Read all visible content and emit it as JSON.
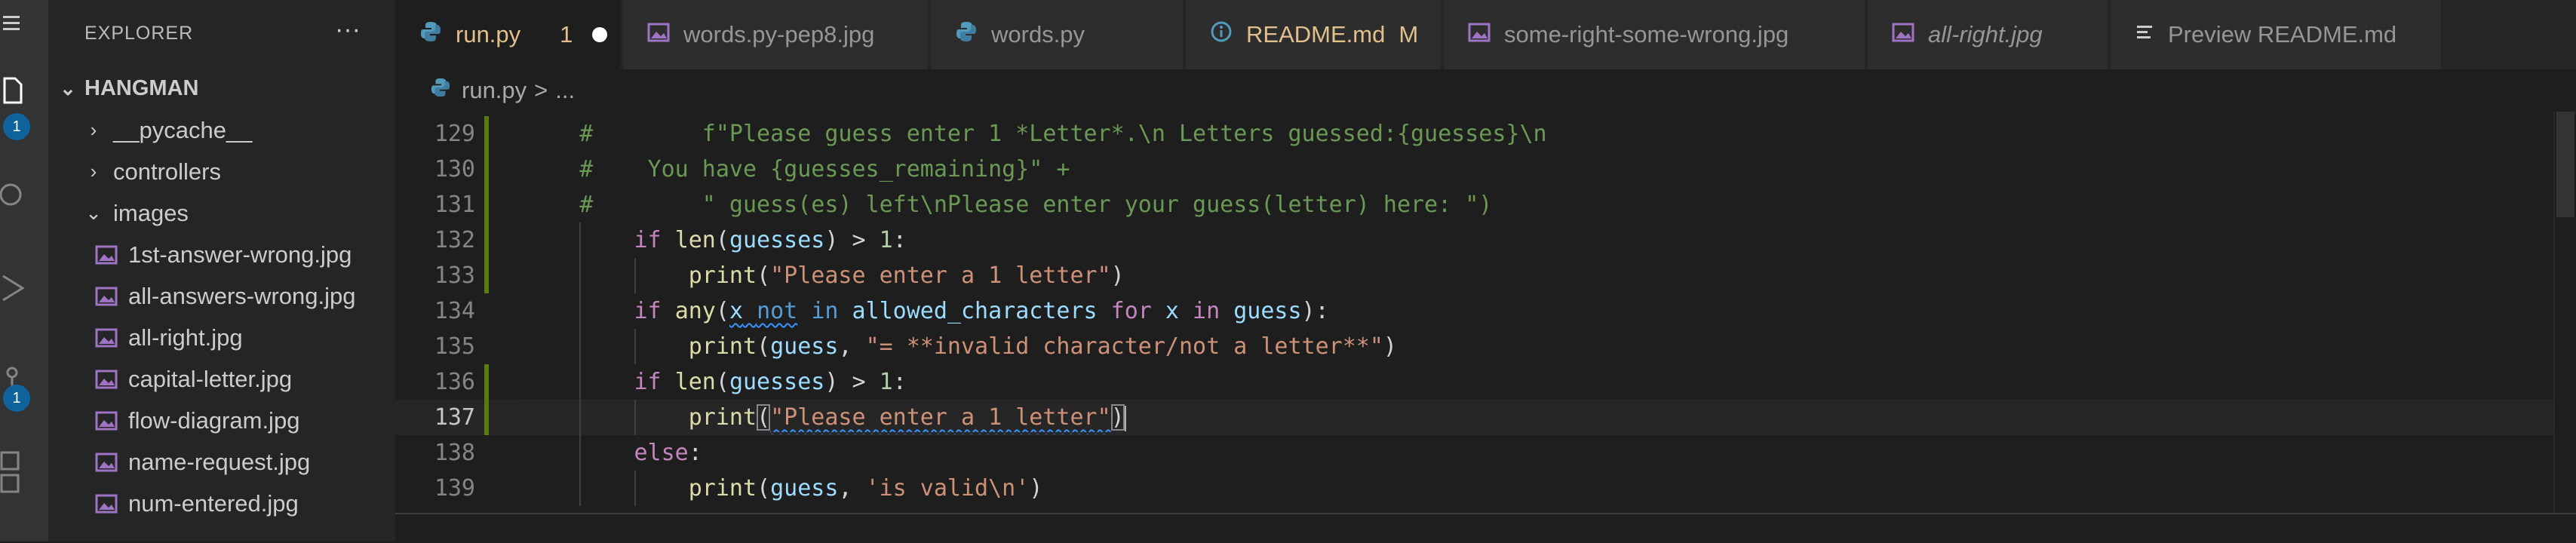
{
  "explorer": {
    "title": "EXPLORER",
    "more_label": "···",
    "root_label": "HANGMAN",
    "items": [
      {
        "label": "__pycache__",
        "kind": "folder",
        "expanded": false
      },
      {
        "label": "controllers",
        "kind": "folder",
        "expanded": false
      },
      {
        "label": "images",
        "kind": "folder",
        "expanded": true
      },
      {
        "label": "1st-answer-wrong.jpg",
        "kind": "image"
      },
      {
        "label": "all-answers-wrong.jpg",
        "kind": "image"
      },
      {
        "label": "all-right.jpg",
        "kind": "image"
      },
      {
        "label": "capital-letter.jpg",
        "kind": "image"
      },
      {
        "label": "flow-diagram.jpg",
        "kind": "image"
      },
      {
        "label": "name-request.jpg",
        "kind": "image"
      },
      {
        "label": "num-entered.jpg",
        "kind": "image"
      }
    ]
  },
  "activity": {
    "explorer_badge": "1",
    "scm_badge": "1"
  },
  "tabs": [
    {
      "label": "run.py",
      "icon": "python-icon",
      "count": "1",
      "unsaved": true,
      "active": true
    },
    {
      "label": "words.py-pep8.jpg",
      "icon": "image-icon"
    },
    {
      "label": "words.py",
      "icon": "python-icon"
    },
    {
      "label": "README.md",
      "icon": "info-icon",
      "status": "M"
    },
    {
      "label": "some-right-some-wrong.jpg",
      "icon": "image-icon"
    },
    {
      "label": "all-right.jpg",
      "icon": "image-icon",
      "italic": true
    },
    {
      "label": "Preview README.md",
      "icon": "preview-icon"
    }
  ],
  "breadcrumb": {
    "file": "run.py",
    "separator": ">",
    "ellipsis": "..."
  },
  "editor": {
    "current_line": "137",
    "lines": [
      {
        "num": "129",
        "indent": 0,
        "tokens": [
          {
            "t": "    #        f\"Please guess enter 1 *Letter*.\\n Letters guessed:{guesses}\\n",
            "c": "comment"
          }
        ]
      },
      {
        "num": "130",
        "indent": 0,
        "tokens": [
          {
            "t": "    #    You have {guesses_remaining}\" +",
            "c": "comment"
          }
        ]
      },
      {
        "num": "131",
        "indent": 0,
        "tokens": [
          {
            "t": "    #        \" guess(es) left\\nPlease enter your guess(letter) here: \")",
            "c": "comment"
          }
        ]
      },
      {
        "num": "132",
        "indent": 1,
        "tokens": [
          {
            "t": "        "
          },
          {
            "t": "if",
            "c": "ctrl"
          },
          {
            "t": " "
          },
          {
            "t": "len",
            "c": "fn"
          },
          {
            "t": "("
          },
          {
            "t": "guesses",
            "c": "var"
          },
          {
            "t": ") > "
          },
          {
            "t": "1",
            "c": "num"
          },
          {
            "t": ":"
          }
        ]
      },
      {
        "num": "133",
        "indent": 2,
        "tokens": [
          {
            "t": "            "
          },
          {
            "t": "print",
            "c": "fn"
          },
          {
            "t": "("
          },
          {
            "t": "\"Please enter a 1 letter\"",
            "c": "str"
          },
          {
            "t": ")"
          }
        ]
      },
      {
        "num": "134",
        "indent": 1,
        "tokens": [
          {
            "t": "        "
          },
          {
            "t": "if",
            "c": "ctrl"
          },
          {
            "t": " "
          },
          {
            "t": "any",
            "c": "fn"
          },
          {
            "t": "("
          },
          {
            "t": "x",
            "c": "var",
            "sq": true
          },
          {
            "t": " ",
            "sq": true
          },
          {
            "t": "not",
            "c": "kw",
            "sq": true
          },
          {
            "t": " "
          },
          {
            "t": "in",
            "c": "kw"
          },
          {
            "t": " "
          },
          {
            "t": "allowed_characters",
            "c": "var"
          },
          {
            "t": " "
          },
          {
            "t": "for",
            "c": "ctrl"
          },
          {
            "t": " "
          },
          {
            "t": "x",
            "c": "var"
          },
          {
            "t": " "
          },
          {
            "t": "in",
            "c": "ctrl"
          },
          {
            "t": " "
          },
          {
            "t": "guess",
            "c": "var"
          },
          {
            "t": "):"
          }
        ]
      },
      {
        "num": "135",
        "indent": 2,
        "tokens": [
          {
            "t": "            "
          },
          {
            "t": "print",
            "c": "fn"
          },
          {
            "t": "("
          },
          {
            "t": "guess",
            "c": "var"
          },
          {
            "t": ", "
          },
          {
            "t": "\"= **invalid character/not a letter**\"",
            "c": "str"
          },
          {
            "t": ")"
          }
        ]
      },
      {
        "num": "136",
        "indent": 1,
        "tokens": [
          {
            "t": "        "
          },
          {
            "t": "if",
            "c": "ctrl"
          },
          {
            "t": " "
          },
          {
            "t": "len",
            "c": "fn"
          },
          {
            "t": "("
          },
          {
            "t": "guesses",
            "c": "var"
          },
          {
            "t": ") > "
          },
          {
            "t": "1",
            "c": "num"
          },
          {
            "t": ":"
          }
        ]
      },
      {
        "num": "137",
        "indent": 2,
        "tokens": [
          {
            "t": "            "
          },
          {
            "t": "print",
            "c": "fn"
          },
          {
            "t": "(",
            "box": true
          },
          {
            "t": "\"Please enter a 1 letter\"",
            "c": "str",
            "sq": true
          },
          {
            "t": ")",
            "box": true
          },
          {
            "cursor": true
          }
        ]
      },
      {
        "num": "138",
        "indent": 1,
        "tokens": [
          {
            "t": "        "
          },
          {
            "t": "else",
            "c": "ctrl"
          },
          {
            "t": ":"
          }
        ]
      },
      {
        "num": "139",
        "indent": 2,
        "tokens": [
          {
            "t": "            "
          },
          {
            "t": "print",
            "c": "fn"
          },
          {
            "t": "("
          },
          {
            "t": "guess",
            "c": "var"
          },
          {
            "t": ", "
          },
          {
            "t": "'is valid\\n'",
            "c": "str"
          },
          {
            "t": ")"
          }
        ]
      }
    ]
  },
  "colors": {
    "accent": "#0e639c",
    "modified": "#e2c08d",
    "gutter_added": "#587c0c"
  }
}
